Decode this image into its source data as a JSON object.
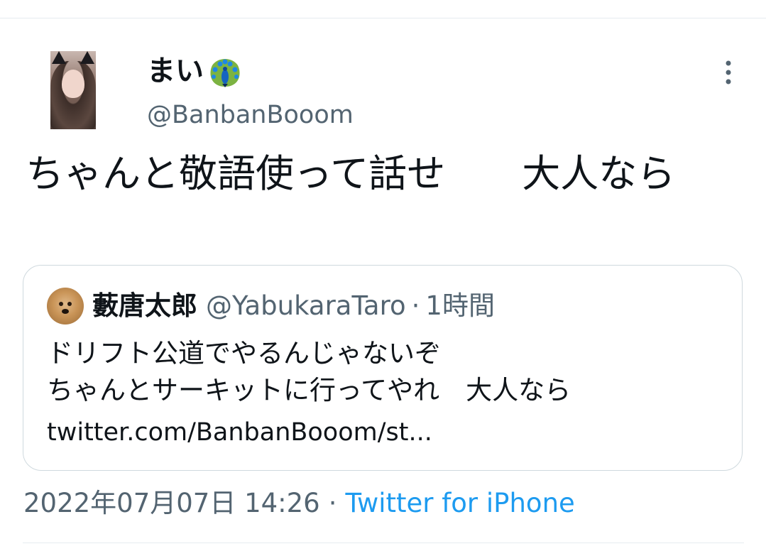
{
  "tweet": {
    "display_name": "まい",
    "name_emoji": "peacock-emoji",
    "handle": "@BanbanBooom",
    "text": "ちゃんと敬語使って話せ　　大人なら",
    "timestamp": "2022年07月07日 14:26",
    "separator": "·",
    "source": "Twitter for iPhone"
  },
  "quote": {
    "name": "藪唐太郎",
    "handle": "@YabukaraTaro",
    "separator": "·",
    "time": "1時間",
    "text": "ドリフト公道でやるんじゃないぞ\nちゃんとサーキットに行ってやれ　大人なら",
    "link": "twitter.com/BanbanBooom/st..."
  },
  "icons": {
    "more": "more-vertical-icon"
  },
  "colors": {
    "text": "#0f1419",
    "secondary": "#536471",
    "link": "#1d9bf0",
    "border": "#cfd9de"
  }
}
